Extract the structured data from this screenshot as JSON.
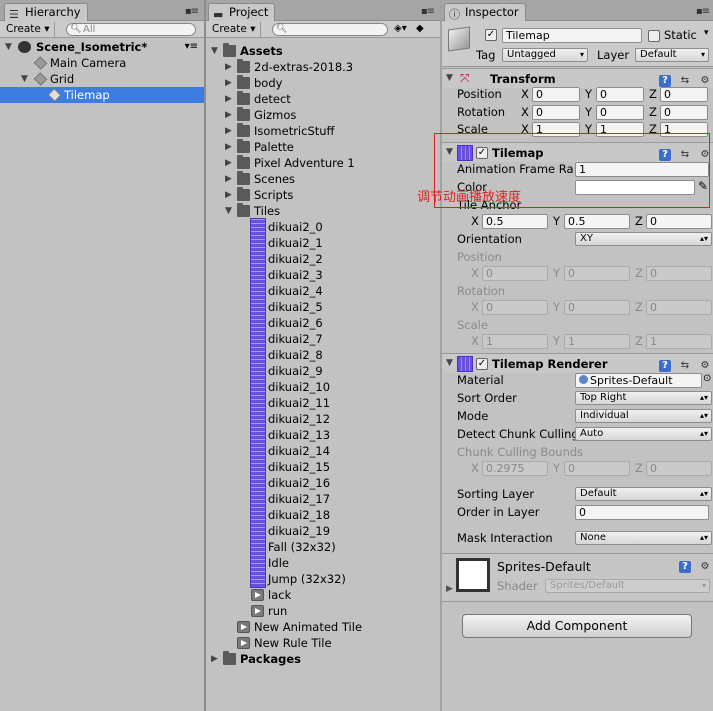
{
  "hierarchy": {
    "tab": "Hierarchy",
    "create": "Create",
    "search_placeholder": "All",
    "scene": "Scene_Isometric*",
    "items": [
      {
        "label": "Main Camera"
      },
      {
        "label": "Grid"
      },
      {
        "label": "Tilemap"
      }
    ]
  },
  "project": {
    "tab": "Project",
    "create": "Create",
    "root": "Assets",
    "folders": [
      "2d-extras-2018.3",
      "body",
      "detect",
      "Gizmos",
      "IsometricStuff",
      "Palette",
      "Pixel Adventure 1",
      "Scenes",
      "Scripts"
    ],
    "tiles_folder": "Tiles",
    "tiles": [
      "dikuai2_0",
      "dikuai2_1",
      "dikuai2_2",
      "dikuai2_3",
      "dikuai2_4",
      "dikuai2_5",
      "dikuai2_6",
      "dikuai2_7",
      "dikuai2_8",
      "dikuai2_9",
      "dikuai2_10",
      "dikuai2_11",
      "dikuai2_12",
      "dikuai2_13",
      "dikuai2_14",
      "dikuai2_15",
      "dikuai2_16",
      "dikuai2_17",
      "dikuai2_18",
      "dikuai2_19",
      "Fall (32x32)",
      "Idle",
      "Jump (32x32)"
    ],
    "anims": [
      "lack",
      "run"
    ],
    "root_assets": [
      "New Animated Tile",
      "New Rule Tile"
    ],
    "packages": "Packages"
  },
  "inspector": {
    "tab": "Inspector",
    "object_name": "Tilemap",
    "static_label": "Static",
    "tag_label": "Tag",
    "tag_value": "Untagged",
    "layer_label": "Layer",
    "layer_value": "Default",
    "transform": {
      "title": "Transform",
      "position_label": "Position",
      "rotation_label": "Rotation",
      "scale_label": "Scale",
      "position": [
        "0",
        "0",
        "0"
      ],
      "rotation": [
        "0",
        "0",
        "0"
      ],
      "scale": [
        "1",
        "1",
        "1"
      ]
    },
    "tilemap": {
      "title": "Tilemap",
      "anim_rate_label": "Animation Frame Ra",
      "anim_rate_value": "1",
      "color_label": "Color",
      "tile_anchor_label": "Tile Anchor",
      "tile_anchor": [
        "0.5",
        "0.5",
        "0"
      ],
      "orientation_label": "Orientation",
      "orientation_value": "XY",
      "position_label": "Position",
      "rotation_label": "Rotation",
      "scale_label": "Scale",
      "position": [
        "0",
        "0",
        "0"
      ],
      "rotation": [
        "0",
        "0",
        "0"
      ],
      "scale": [
        "1",
        "1",
        "1"
      ]
    },
    "renderer": {
      "title": "Tilemap Renderer",
      "material_label": "Material",
      "material_value": "Sprites-Default",
      "sort_order_label": "Sort Order",
      "sort_order_value": "Top Right",
      "mode_label": "Mode",
      "mode_value": "Individual",
      "chunk_label": "Detect Chunk Culling",
      "chunk_value": "Auto",
      "bounds_label": "Chunk Culling Bounds",
      "bounds": [
        "0.2975",
        "0",
        "0"
      ],
      "sorting_layer_label": "Sorting Layer",
      "sorting_layer_value": "Default",
      "order_label": "Order in Layer",
      "order_value": "0",
      "mask_label": "Mask Interaction",
      "mask_value": "None"
    },
    "material": {
      "name": "Sprites-Default",
      "shader_label": "Shader",
      "shader_value": "Sprites/Default"
    },
    "add_component": "Add Component"
  },
  "axes": {
    "x": "X",
    "y": "Y",
    "z": "Z"
  },
  "annotation": "调节动画播放速度",
  "colors": {
    "selection": "#3e7ce0",
    "annotation": "#e02020",
    "tile_icon": "#6b4fe0"
  }
}
